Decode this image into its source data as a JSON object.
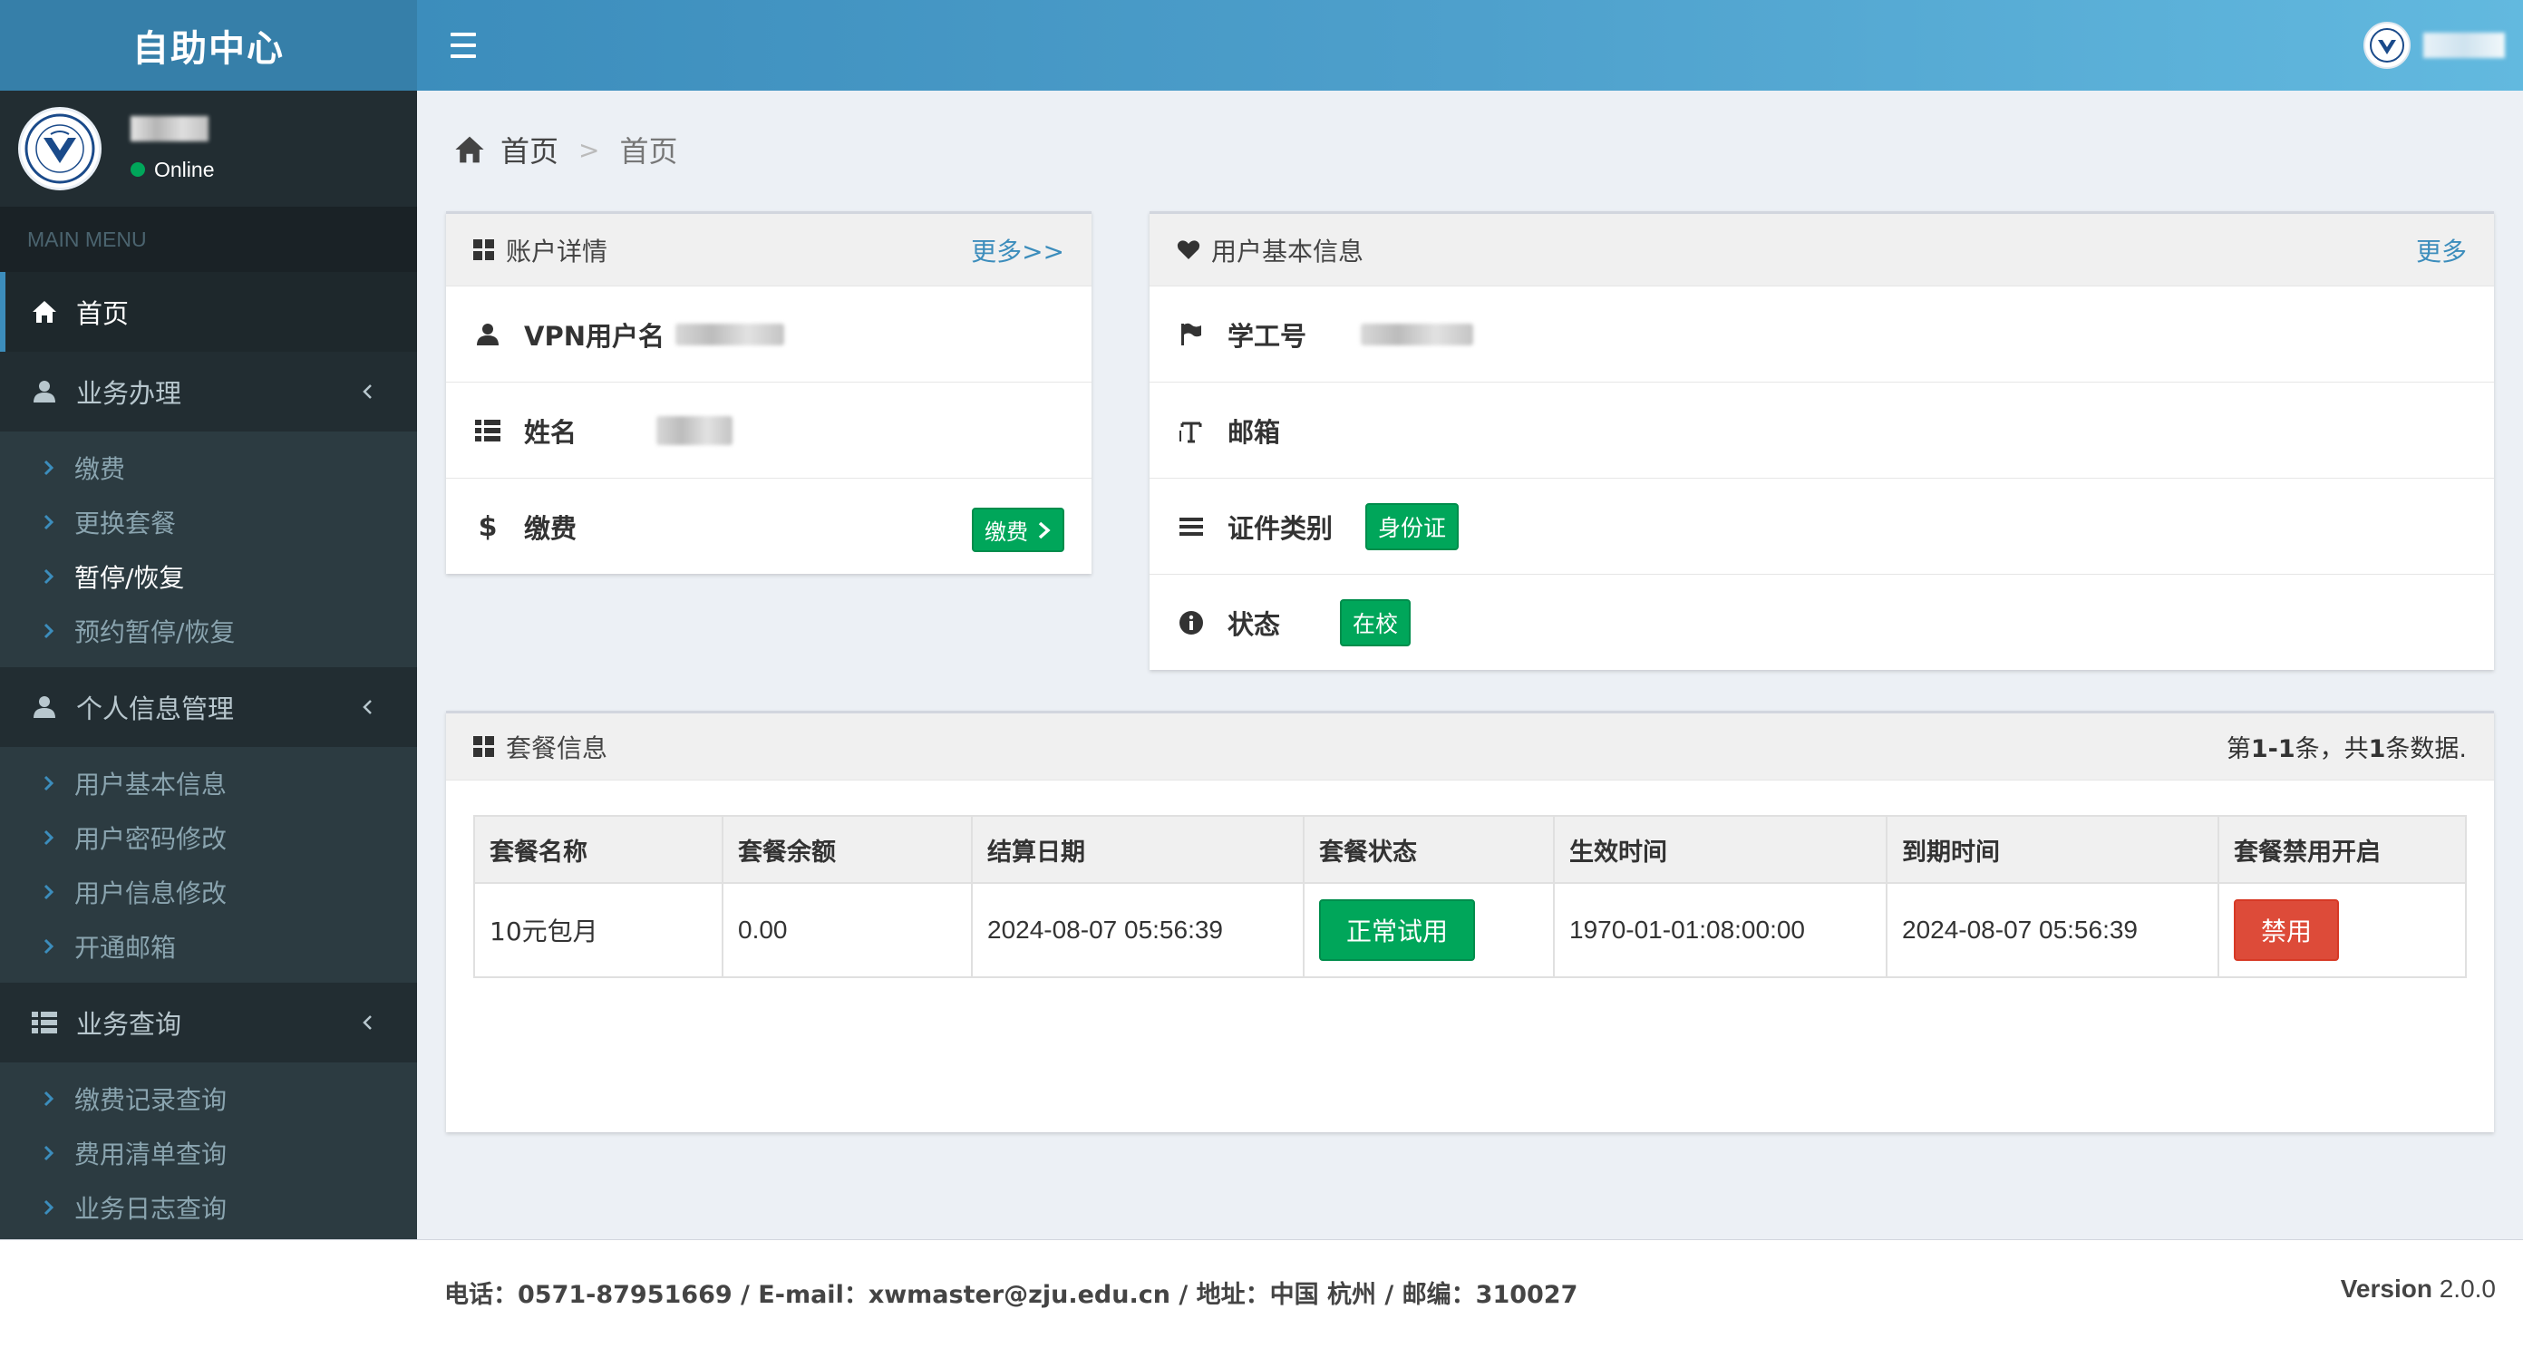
{
  "app": {
    "logo_text": "自助中心"
  },
  "user": {
    "status": "Online"
  },
  "sidebar": {
    "header": "MAIN MENU",
    "home": "首页",
    "groups": [
      {
        "label": "业务办理",
        "items": [
          "缴费",
          "更换套餐",
          "暂停/恢复",
          "预约暂停/恢复"
        ]
      },
      {
        "label": "个人信息管理",
        "items": [
          "用户基本信息",
          "用户密码修改",
          "用户信息修改",
          "开通邮箱"
        ]
      },
      {
        "label": "业务查询",
        "items": [
          "缴费记录查询",
          "费用清单查询",
          "业务日志查询"
        ]
      }
    ]
  },
  "breadcrumb": {
    "home": "首页",
    "sep": ">",
    "current": "首页"
  },
  "account": {
    "title": "账户详情",
    "more": "更多>>",
    "vpn_label": "VPN用户名",
    "name_label": "姓名",
    "pay_label": "缴费",
    "pay_button": "缴费"
  },
  "userinfo": {
    "title": "用户基本信息",
    "more": "更多",
    "id_label": "学工号",
    "email_label": "邮箱",
    "cert_label": "证件类别",
    "cert_value": "身份证",
    "status_label": "状态",
    "status_value": "在校"
  },
  "package": {
    "title": "套餐信息",
    "summary_pre": "第",
    "summary_range": "1-1",
    "summary_mid": "条，共",
    "summary_total": "1",
    "summary_post": "条数据.",
    "columns": [
      "套餐名称",
      "套餐余额",
      "结算日期",
      "套餐状态",
      "生效时间",
      "到期时间",
      "套餐禁用开启"
    ],
    "row": {
      "name": "10元包月",
      "balance": "0.00",
      "settle_date": "2024-08-07 05:56:39",
      "status": "正常试用",
      "effective": "1970-01-01:08:00:00",
      "expire": "2024-08-07 05:56:39",
      "action": "禁用"
    }
  },
  "footer": {
    "contact": "电话：0571-87951669 / E-mail：xwmaster@zju.edu.cn / 地址：中国 杭州 / 邮编：310027",
    "version_label": "Version",
    "version_value": "2.0.0"
  },
  "colors": {
    "header": "#3c8dbc",
    "logo_bg": "#367fa9",
    "sidebar": "#222d32",
    "green": "#00a65a",
    "red": "#dd4b39"
  }
}
